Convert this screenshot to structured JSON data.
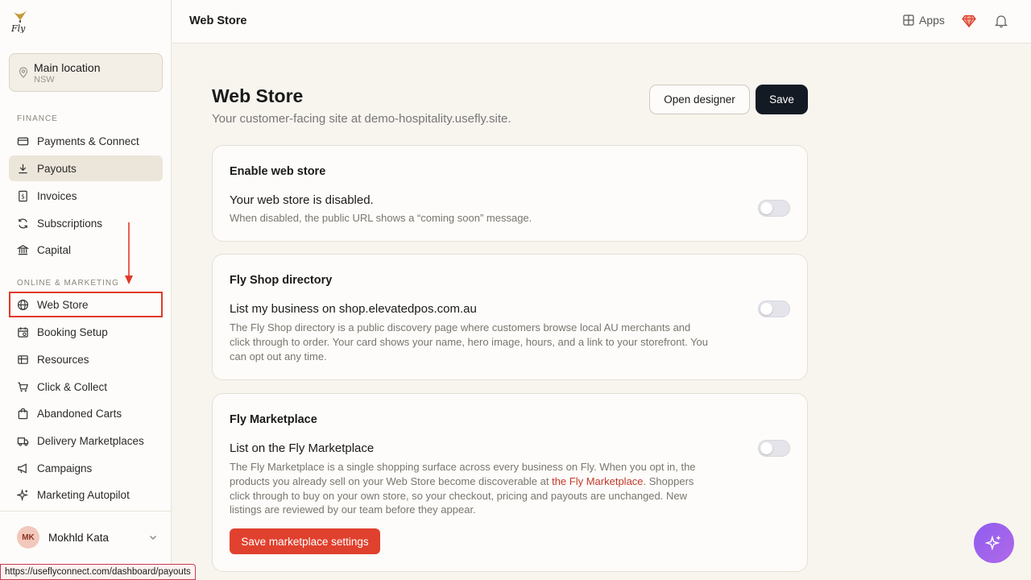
{
  "brand": {
    "logo_text": "Fly"
  },
  "location": {
    "name": "Main location",
    "region": "NSW"
  },
  "sidebar": {
    "sections": [
      {
        "label": "FINANCE",
        "items": [
          {
            "label": "Payments & Connect",
            "icon": "credit-card-icon"
          },
          {
            "label": "Payouts",
            "icon": "download-icon"
          },
          {
            "label": "Invoices",
            "icon": "invoice-icon"
          },
          {
            "label": "Subscriptions",
            "icon": "refresh-icon"
          },
          {
            "label": "Capital",
            "icon": "bank-icon"
          }
        ]
      },
      {
        "label": "ONLINE & MARKETING",
        "items": [
          {
            "label": "Web Store",
            "icon": "globe-icon"
          },
          {
            "label": "Booking Setup",
            "icon": "calendar-icon"
          },
          {
            "label": "Resources",
            "icon": "resources-icon"
          },
          {
            "label": "Click & Collect",
            "icon": "cart-icon"
          },
          {
            "label": "Abandoned Carts",
            "icon": "bag-icon"
          },
          {
            "label": "Delivery Marketplaces",
            "icon": "truck-icon"
          },
          {
            "label": "Campaigns",
            "icon": "megaphone-icon"
          },
          {
            "label": "Marketing Autopilot",
            "icon": "sparkle-icon"
          }
        ]
      }
    ]
  },
  "user": {
    "initials": "MK",
    "name": "Mokhld Kata"
  },
  "status_url": "https://useflyconnect.com/dashboard/payouts",
  "topbar": {
    "title": "Web Store",
    "apps_label": "Apps"
  },
  "page": {
    "title": "Web Store",
    "subtitle": "Your customer-facing site at demo-hospitality.usefly.site.",
    "open_designer_label": "Open designer",
    "save_label": "Save"
  },
  "cards": {
    "enable": {
      "title": "Enable web store",
      "row_title": "Your web store is disabled.",
      "row_desc": "When disabled, the public URL shows a “coming soon” message.",
      "enabled": false
    },
    "directory": {
      "title": "Fly Shop directory",
      "row_title": "List my business on shop.elevatedpos.com.au",
      "row_desc": "The Fly Shop directory is a public discovery page where customers browse local AU merchants and click through to order. Your card shows your name, hero image, hours, and a link to your storefront. You can opt out any time.",
      "enabled": false
    },
    "marketplace": {
      "title": "Fly Marketplace",
      "row_title": "List on the Fly Marketplace",
      "row_desc_1": "The Fly Marketplace is a single shopping surface across every business on Fly. When you opt in, the products you already sell on your Web Store become discoverable at ",
      "row_desc_link": "the Fly Marketplace",
      "row_desc_2": ". Shoppers click through to buy on your own store, so your checkout, pricing and payouts are unchanged. New listings are reviewed by our team before they appear.",
      "enabled": false,
      "save_button_label": "Save marketplace settings"
    }
  },
  "colors": {
    "accent_red": "#e0412e",
    "primary_dark": "#141a24",
    "page_bg": "#f8f5ef",
    "assistant_purple": "#9a62ee"
  }
}
